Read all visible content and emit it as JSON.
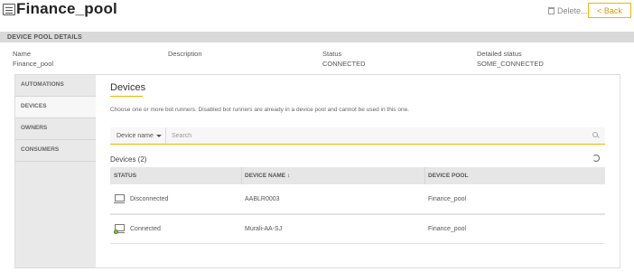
{
  "header": {
    "title": "Finance_pool",
    "delete_label": "Delete...",
    "back_label": "< Back"
  },
  "details": {
    "section_label": "DEVICE POOL DETAILS",
    "fields": [
      {
        "label": "Name",
        "value": "Finance_pool"
      },
      {
        "label": "Description",
        "value": ""
      },
      {
        "label": "Status",
        "value": "CONNECTED"
      },
      {
        "label": "Detailed status",
        "value": "SOME_CONNECTED"
      }
    ]
  },
  "sidebar": {
    "items": [
      {
        "label": "AUTOMATIONS"
      },
      {
        "label": "DEVICES"
      },
      {
        "label": "OWNERS"
      },
      {
        "label": "CONSUMERS"
      }
    ],
    "active": "DEVICES"
  },
  "devices": {
    "title": "Devices",
    "help": "Choose one or more bot runners. Disabled bot runners are already in a device pool and cannot be used in this one.",
    "filter_label": "Device name",
    "search_placeholder": "Search",
    "count_label": "Devices (2)",
    "columns": [
      "STATUS",
      "DEVICE NAME ↕",
      "DEVICE POOL"
    ],
    "rows": [
      {
        "status": "Disconnected",
        "name": "AABLR0003",
        "pool": "Finance_pool",
        "icon": "pc-disconnected-icon"
      },
      {
        "status": "Connected",
        "name": "Murali-AA-SJ",
        "pool": "Finance_pool",
        "icon": "pc-connected-icon"
      }
    ]
  },
  "colors": {
    "accent": "#f0b400",
    "connected": "#8bb44a"
  }
}
